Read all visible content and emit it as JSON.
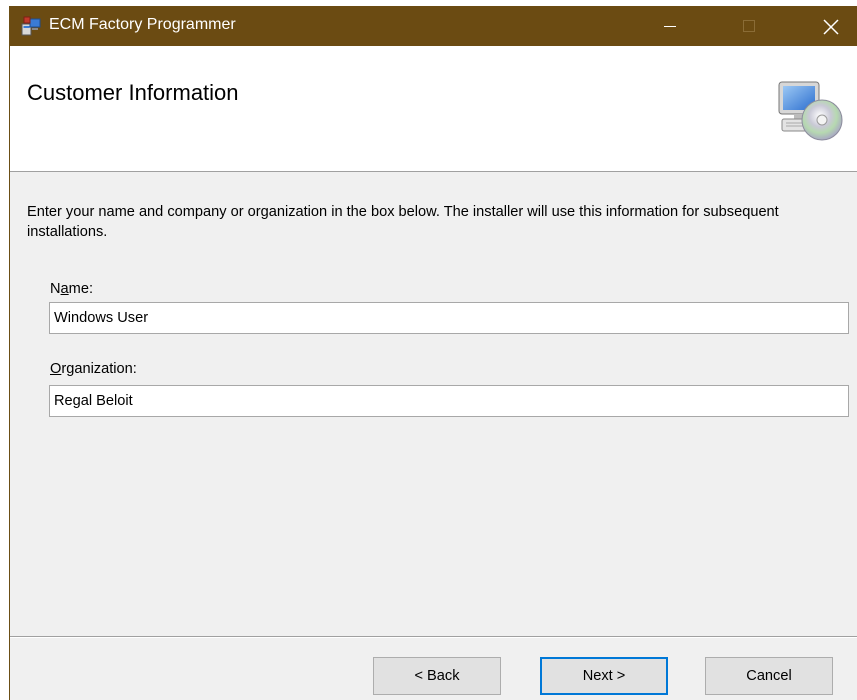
{
  "window": {
    "title": "ECM Factory Programmer",
    "app_icon": "installer-icon",
    "controls": {
      "minimize_icon": "minimize-icon",
      "maximize_icon": "maximize-icon",
      "close_icon": "close-icon"
    },
    "titlebar_color": "#6b4b12"
  },
  "header": {
    "title": "Customer Information",
    "graphic_icon": "computer-with-disc-icon"
  },
  "content": {
    "description": "Enter your name and company or organization in the box below. The installer will use this information for subsequent installations.",
    "name_field": {
      "label_pre": "N",
      "label_accel": "a",
      "label_post": "me:",
      "value": "Windows User"
    },
    "organization_field": {
      "label_pre": "",
      "label_accel": "O",
      "label_post": "rganization:",
      "value": "Regal Beloit"
    }
  },
  "footer": {
    "back_label": "< Back",
    "next_label": "Next >",
    "cancel_label": "Cancel",
    "default_button_color": "#0078d7"
  }
}
